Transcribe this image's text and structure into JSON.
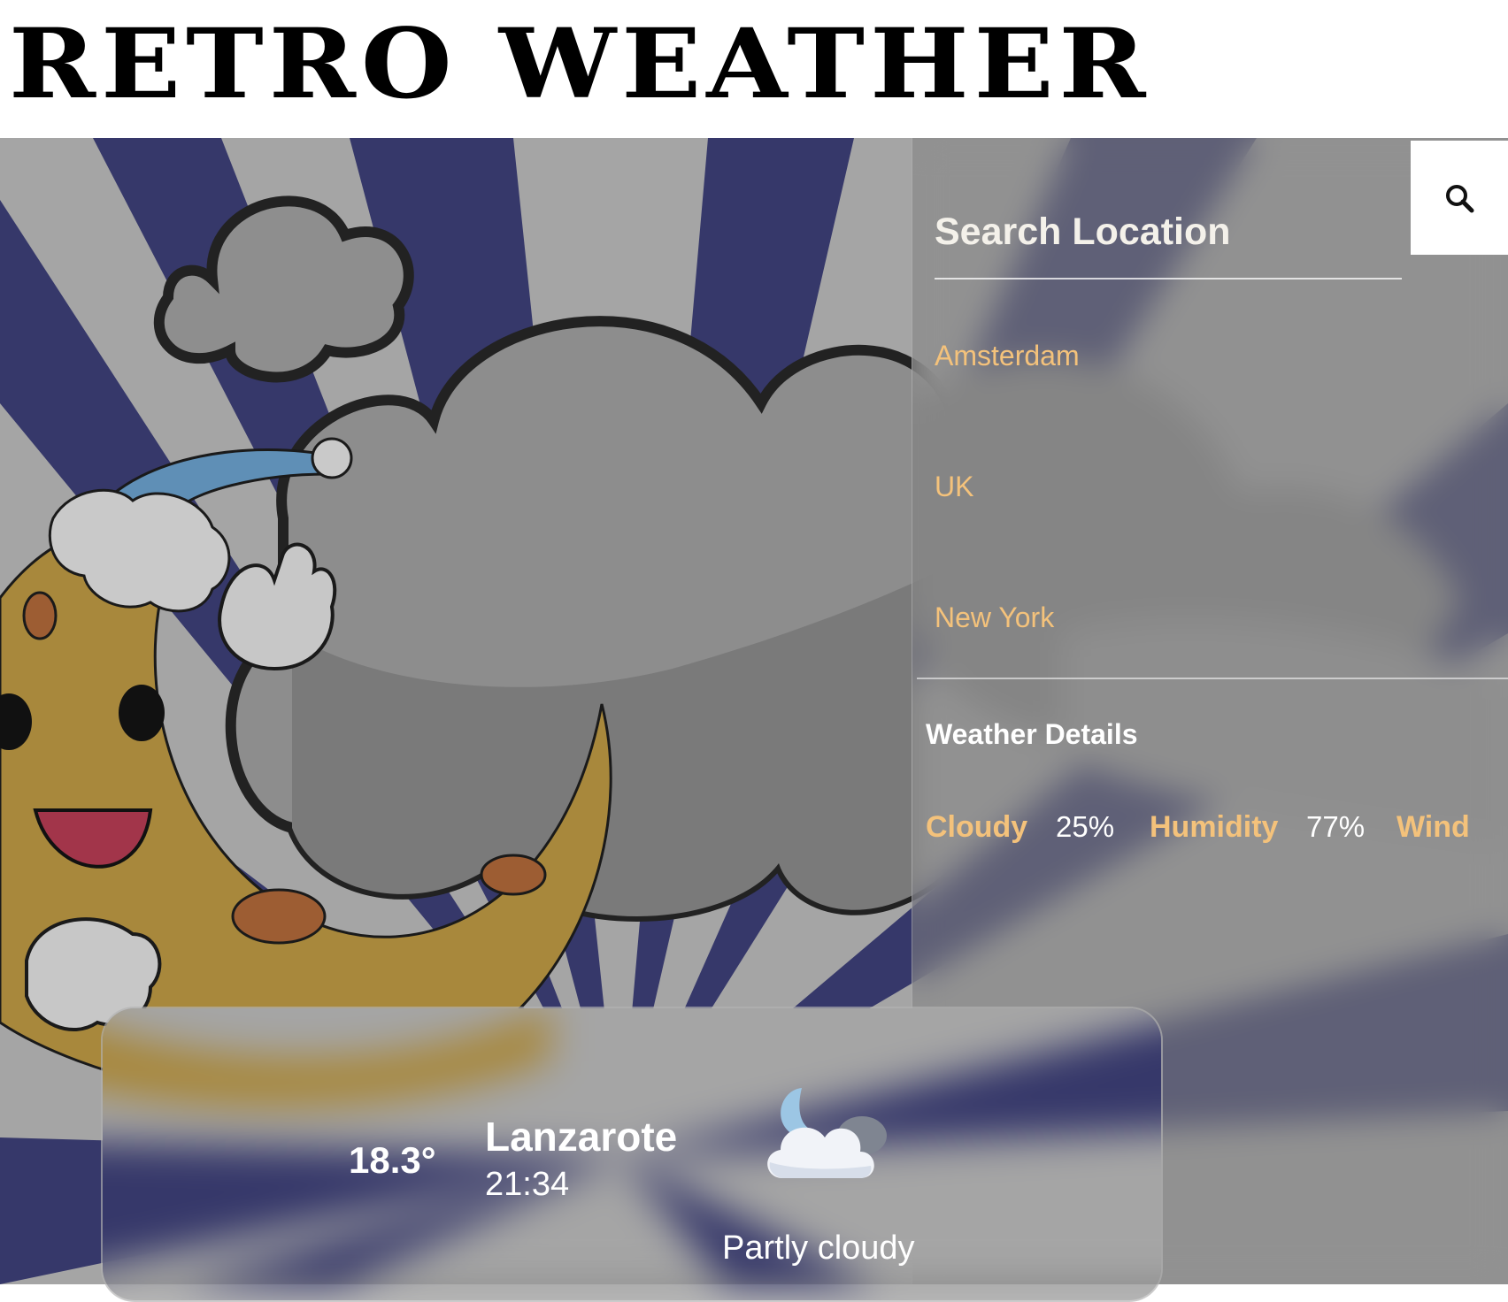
{
  "header": {
    "title": "RETRO WEATHER"
  },
  "search": {
    "placeholder": "Search Location",
    "button_icon": "search-icon"
  },
  "locations": [
    {
      "label": "Amsterdam"
    },
    {
      "label": "UK"
    },
    {
      "label": "New York"
    }
  ],
  "details": {
    "title": "Weather Details",
    "items": [
      {
        "label": "Cloudy",
        "value": "25%"
      },
      {
        "label": "Humidity",
        "value": "77%"
      },
      {
        "label": "Wind",
        "value": ""
      }
    ]
  },
  "current": {
    "temperature": "18.3°",
    "city": "Lanzarote",
    "time": "21:34",
    "condition": "Partly cloudy",
    "condition_icon": "partly-cloudy-night-icon"
  },
  "colors": {
    "accent": "#f4c27b",
    "ray_dark": "#36386a",
    "ray_light": "#a7a7a7",
    "moon": "#a8883c",
    "cloud": "#8c8c8c"
  }
}
